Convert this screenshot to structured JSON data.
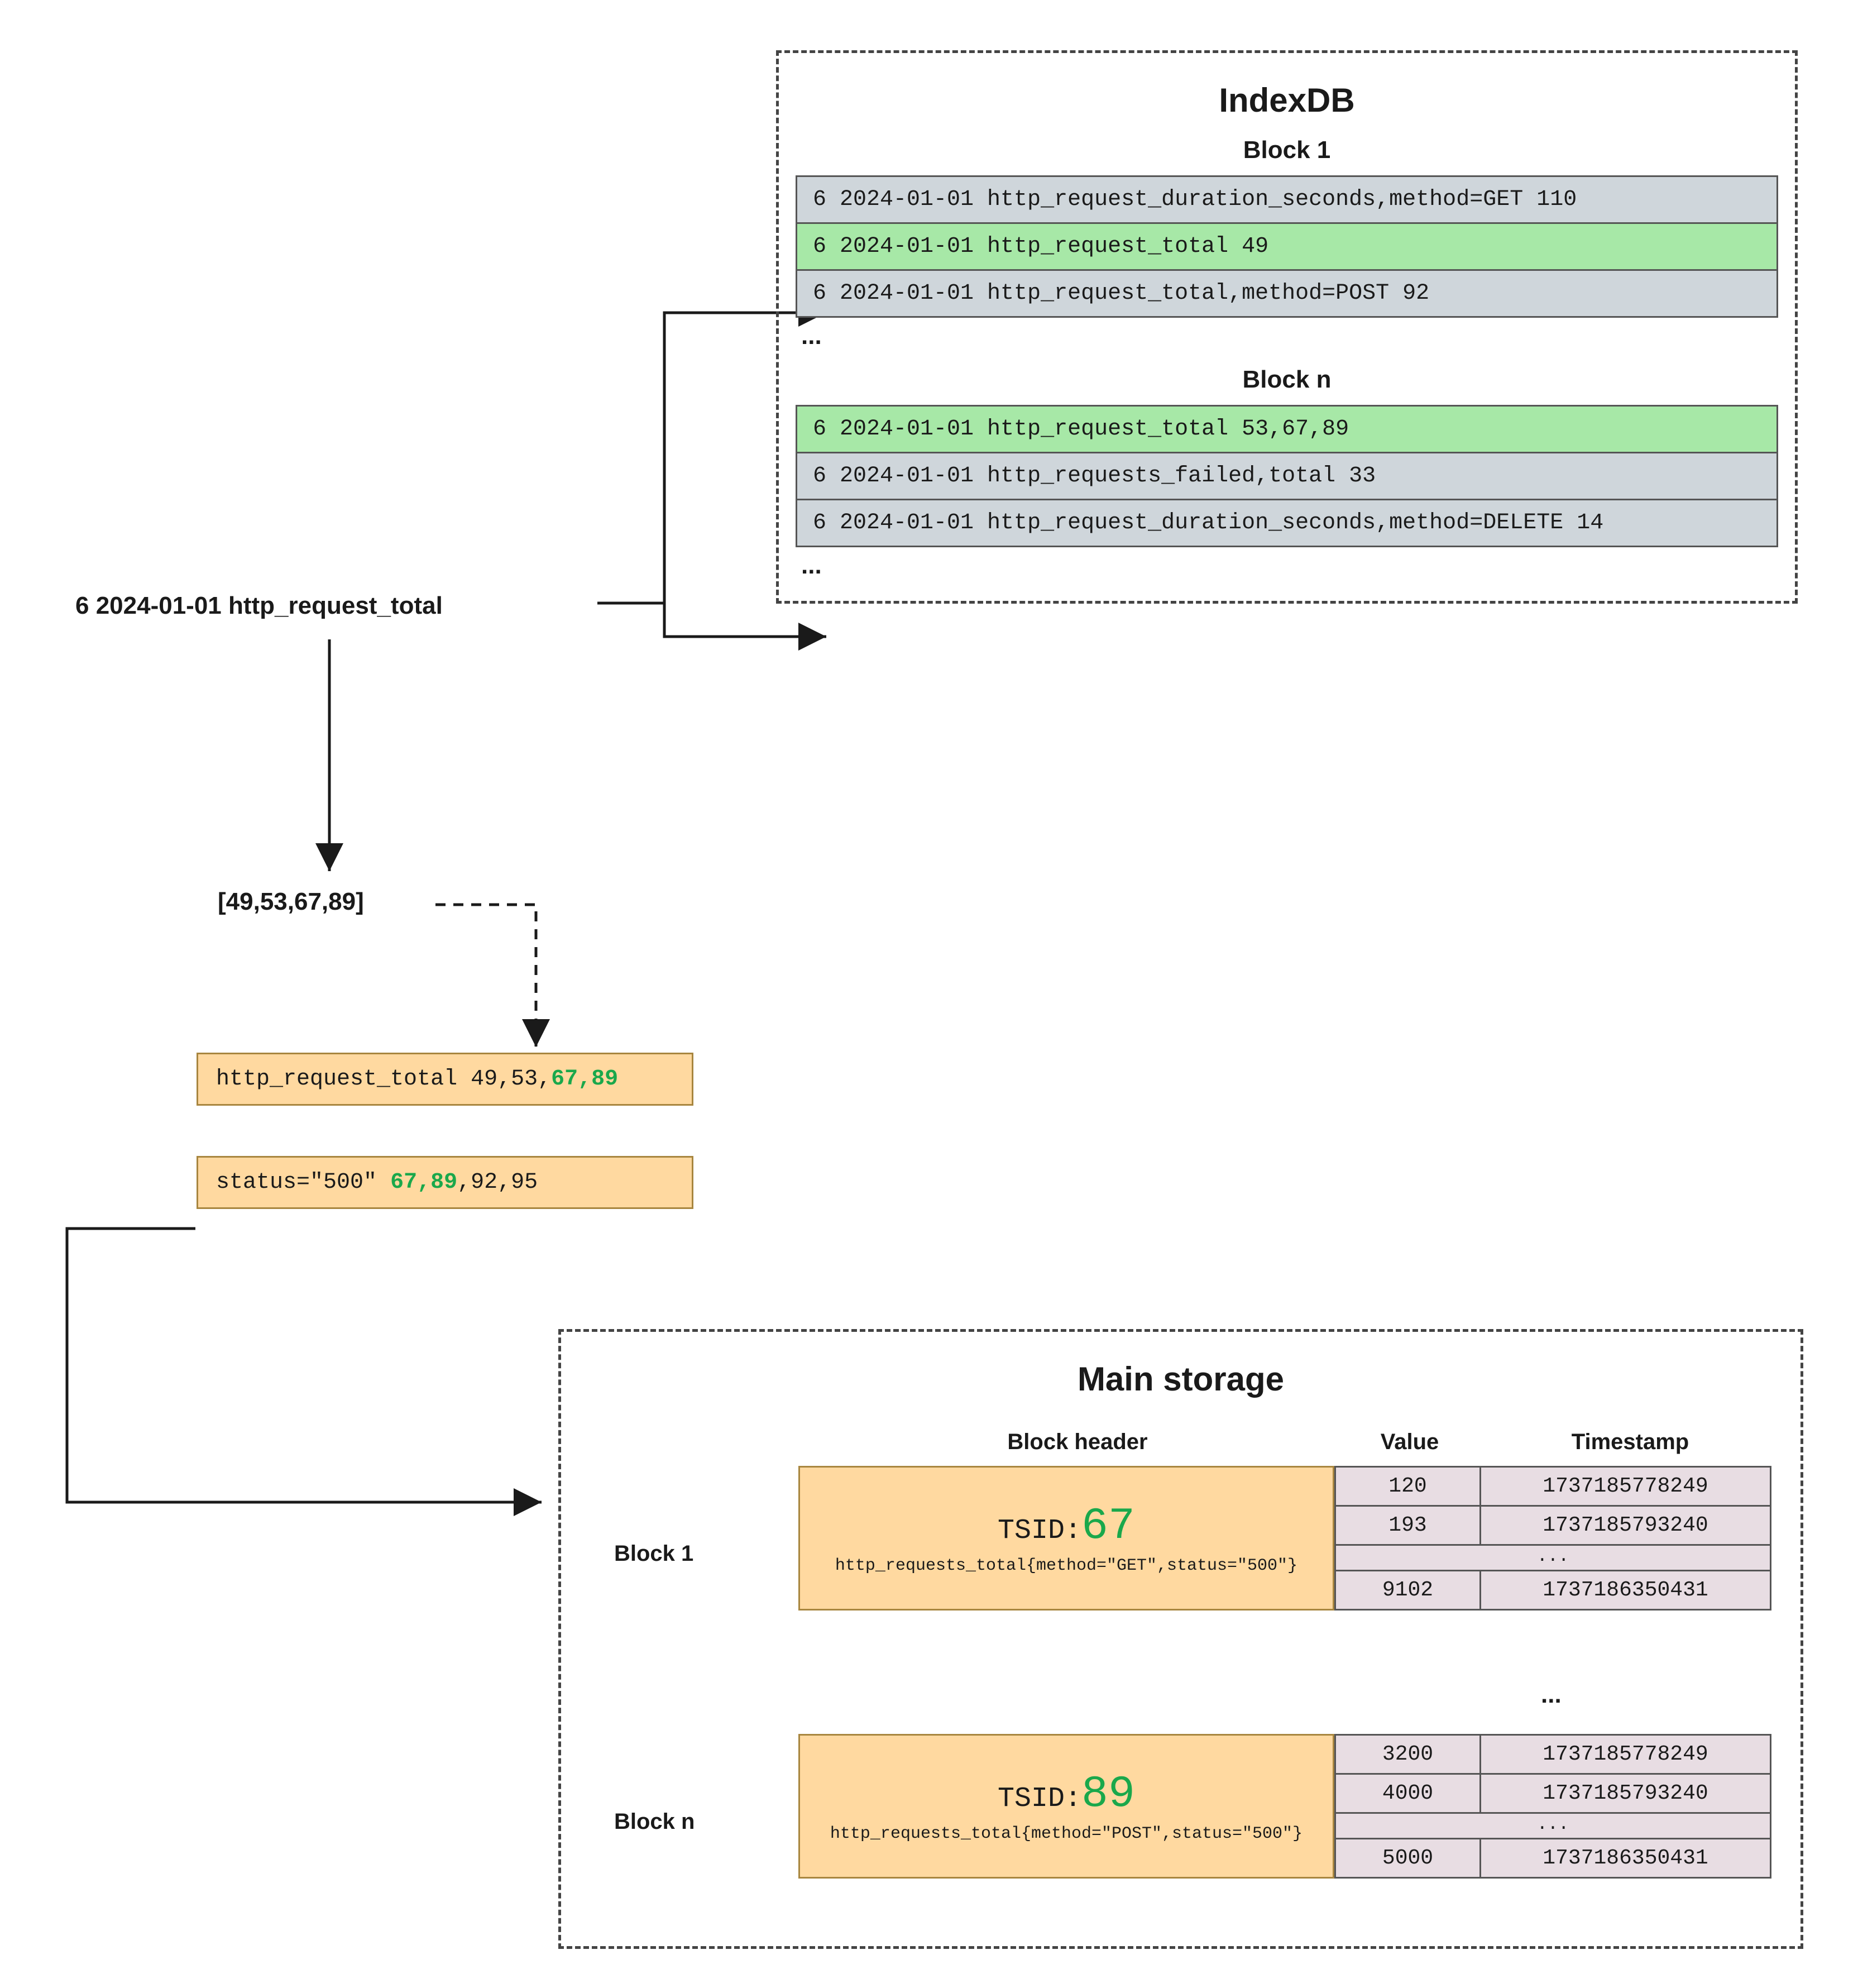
{
  "query_label": "6 2024-01-01 http_request_total",
  "result_ids": "[49,53,67,89]",
  "indexdb": {
    "title": "IndexDB",
    "block1_title": "Block 1",
    "block1_rows": [
      "6 2024-01-01 http_request_duration_seconds,method=GET 110",
      "6 2024-01-01 http_request_total 49",
      "6 2024-01-01 http_request_total,method=POST 92"
    ],
    "block1_ellipsis": "...",
    "blockn_title": "Block n",
    "blockn_rows": [
      "6 2024-01-01 http_request_total 53,67,89",
      "6 2024-01-01 http_requests_failed,total 33",
      "6 2024-01-01 http_request_duration_seconds,method=DELETE 14"
    ],
    "blockn_ellipsis": "..."
  },
  "cache": {
    "row1_prefix": "http_request_total 49,53,",
    "row1_green": "67,89",
    "row2_prefix": "status=\"500\" ",
    "row2_green": "67,89",
    "row2_suffix": ",92,95"
  },
  "storage": {
    "title": "Main storage",
    "col_blockheader": "Block header",
    "col_value": "Value",
    "col_timestamp": "Timestamp",
    "block1_label": "Block 1",
    "block1_tsid_label": "TSID:",
    "block1_tsid_value": "67",
    "block1_metric": "http_requests_total{method=\"GET\",status=\"500\"}",
    "block1_rows": [
      {
        "v": "120",
        "t": "1737185778249"
      },
      {
        "v": "193",
        "t": "1737185793240"
      },
      {
        "v": "9102",
        "t": "1737186350431"
      }
    ],
    "mid_ellipsis": "...",
    "blockn_label": "Block n",
    "blockn_tsid_label": "TSID:",
    "blockn_tsid_value": "89",
    "blockn_metric": "http_requests_total{method=\"POST\",status=\"500\"}",
    "blockn_rows": [
      {
        "v": "3200",
        "t": "1737185778249"
      },
      {
        "v": "4000",
        "t": "1737185793240"
      },
      {
        "v": "5000",
        "t": "1737186350431"
      }
    ],
    "row_ellipsis": "..."
  }
}
